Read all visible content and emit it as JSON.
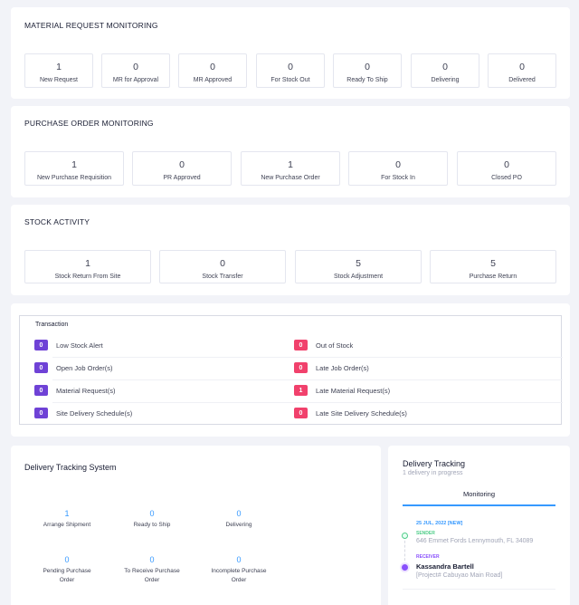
{
  "material_request": {
    "title": "MATERIAL REQUEST MONITORING",
    "stats": [
      {
        "value": "1",
        "label": "New Request"
      },
      {
        "value": "0",
        "label": "MR for Approval"
      },
      {
        "value": "0",
        "label": "MR Approved"
      },
      {
        "value": "0",
        "label": "For Stock Out"
      },
      {
        "value": "0",
        "label": "Ready To Ship"
      },
      {
        "value": "0",
        "label": "Delivering"
      },
      {
        "value": "0",
        "label": "Delivered"
      }
    ]
  },
  "purchase_order": {
    "title": "PURCHASE ORDER MONITORING",
    "stats": [
      {
        "value": "1",
        "label": "New Purchase Requisition"
      },
      {
        "value": "0",
        "label": "PR Approved"
      },
      {
        "value": "1",
        "label": "New Purchase Order"
      },
      {
        "value": "0",
        "label": "For Stock In"
      },
      {
        "value": "0",
        "label": "Closed PO"
      }
    ]
  },
  "stock_activity": {
    "title": "STOCK ACTIVITY",
    "stats": [
      {
        "value": "1",
        "label": "Stock Return From Site"
      },
      {
        "value": "0",
        "label": "Stock Transfer"
      },
      {
        "value": "5",
        "label": "Stock Adjustment"
      },
      {
        "value": "5",
        "label": "Purchase Return"
      }
    ]
  },
  "transaction": {
    "title": "Transaction",
    "left": [
      {
        "count": "0",
        "label": "Low Stock Alert"
      },
      {
        "count": "0",
        "label": "Open Job Order(s)"
      },
      {
        "count": "0",
        "label": "Material Request(s)"
      },
      {
        "count": "0",
        "label": "Site Delivery Schedule(s)"
      }
    ],
    "right": [
      {
        "count": "0",
        "label": "Out of Stock"
      },
      {
        "count": "0",
        "label": "Late Job Order(s)"
      },
      {
        "count": "1",
        "label": "Late Material Request(s)"
      },
      {
        "count": "0",
        "label": "Late Site Delivery Schedule(s)"
      }
    ],
    "colors": {
      "left_badge": "#6f42d6",
      "right_badge": "#f1416c"
    }
  },
  "delivery_system": {
    "title": "Delivery Tracking System",
    "items": [
      {
        "value": "1",
        "label": "Arrange Shipment"
      },
      {
        "value": "0",
        "label": "Ready to Ship"
      },
      {
        "value": "0",
        "label": "Delivering"
      },
      {
        "value": "0",
        "label": "Pending Purchase Order"
      },
      {
        "value": "0",
        "label": "To Receive Purchase Order"
      },
      {
        "value": "0",
        "label": "Incomplete Purchase Order"
      }
    ]
  },
  "delivery_tracking": {
    "title": "Delivery Tracking",
    "subtitle": "1 delivery in progress",
    "tab": "Monitoring",
    "date": "25 JUL, 2022 [NEW]",
    "sender_label": "SENDER",
    "sender_address": "646 Emmet Fords Lennymouth, FL 34089",
    "receiver_label": "RECEIVER",
    "receiver_name": "Kassandra Bartell",
    "receiver_project": "[Project# Cabuyao Main Road]"
  }
}
